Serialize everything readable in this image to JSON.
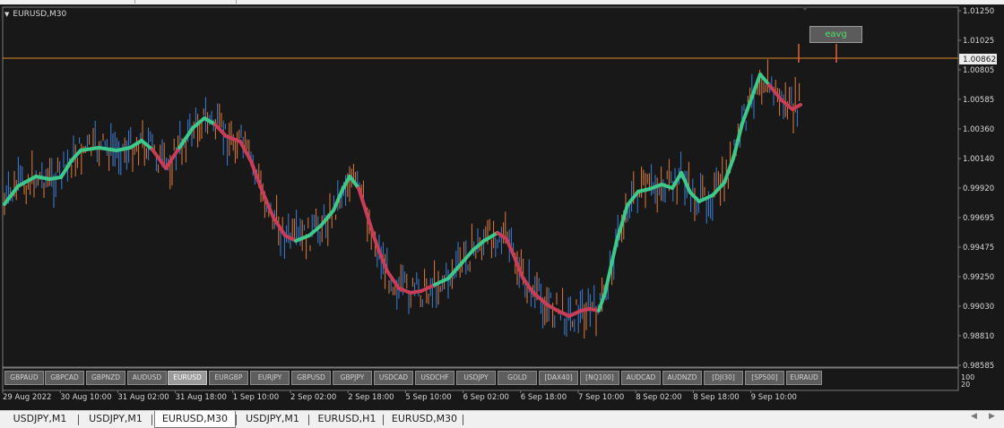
{
  "symbol_title": "EURUSD,M30",
  "current_price": "1.00862",
  "indicator_button": "eavg",
  "price_axis": [
    "1.01250",
    "1.01025",
    "1.00805",
    "1.00585",
    "1.00360",
    "1.00140",
    "0.99920",
    "0.99695",
    "0.99475",
    "0.99250",
    "0.99030",
    "0.98810",
    "0.98585"
  ],
  "indicator_axis": [
    "100",
    "20"
  ],
  "time_axis": [
    "29 Aug 2022",
    "30 Aug 10:00",
    "31 Aug 02:00",
    "31 Aug 18:00",
    "1 Sep 10:00",
    "2 Sep 02:00",
    "2 Sep 18:00",
    "5 Sep 10:00",
    "6 Sep 02:00",
    "6 Sep 18:00",
    "7 Sep 10:00",
    "8 Sep 02:00",
    "8 Sep 18:00",
    "9 Sep 10:00"
  ],
  "symbol_buttons": [
    "GBPAUD",
    "GBPCAD",
    "GBPNZD",
    "AUDUSD",
    "EURUSD",
    "EURGBP",
    "EURJPY",
    "GBPUSD",
    "GBPJPY",
    "USDCAD",
    "USDCHF",
    "USDJPY",
    "GOLD",
    "[DAX40]",
    "[NQ100]",
    "AUDCAD",
    "AUDNZD",
    "[DJI30]",
    "[SP500]",
    "EURAUD"
  ],
  "active_symbol": "EURUSD",
  "tabs": [
    "USDJPY,M1",
    "USDJPY,M1",
    "EURUSD,M30",
    "USDJPY,M1",
    "EURUSD,H1",
    "EURUSD,M30"
  ],
  "active_tab_index": 2,
  "colors": {
    "background": "#181818",
    "bull_bar": "#3d7fd6",
    "bear_bar": "#e07a3c",
    "ma_up": "#3ec88a",
    "ma_down": "#c83e58",
    "price_line": "#e08a22",
    "axis_text": "#d8d8d8"
  },
  "scroll_icons": [
    "scroll-left-icon",
    "scroll-right-icon"
  ]
}
